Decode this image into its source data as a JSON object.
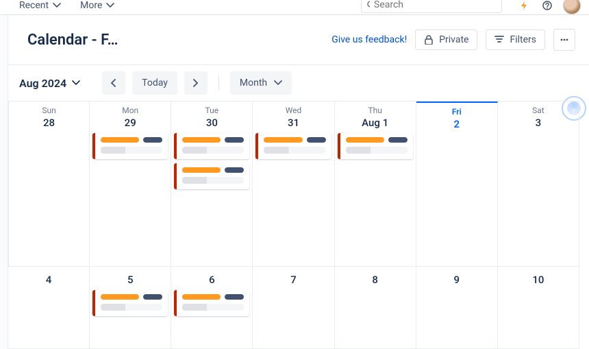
{
  "nav": {
    "recent": "Recent",
    "more": "More",
    "search_placeholder": "Search"
  },
  "header": {
    "title": "Calendar - F…",
    "feedback": "Give us feedback!",
    "private": "Private",
    "filters": "Filters"
  },
  "toolbar": {
    "month_label": "Aug 2024",
    "today": "Today",
    "view": "Month"
  },
  "days": {
    "names": [
      "Sun",
      "Mon",
      "Tue",
      "Wed",
      "Thu",
      "Fri",
      "Sat"
    ],
    "row1_nums": [
      "28",
      "29",
      "30",
      "31",
      "Aug 1",
      "2",
      "3"
    ],
    "row2_nums": [
      "4",
      "5",
      "6",
      "7",
      "8",
      "9",
      "10"
    ]
  },
  "events": {
    "row1": {
      "sun": 0,
      "mon": 1,
      "tue": 2,
      "wed": 1,
      "thu": 1,
      "fri": 0,
      "sat": 0
    },
    "row2": {
      "sun": 0,
      "mon": 1,
      "tue": 1,
      "wed": 0,
      "thu": 0,
      "fri": 0,
      "sat": 0
    }
  },
  "icons": {
    "chevron_down": "chevron-down-icon",
    "search": "search-icon",
    "bolt": "bolt-icon",
    "help": "help-icon",
    "lock": "lock-icon",
    "filter": "filter-icon",
    "more_h": "more-horizontal-icon",
    "chevron_left": "chevron-left-icon",
    "chevron_right": "chevron-right-icon"
  },
  "colors": {
    "accent": "#0065ff",
    "event_accent": "#bf2600",
    "event_bar_primary": "#ff991f",
    "event_bar_secondary": "#42526e"
  }
}
